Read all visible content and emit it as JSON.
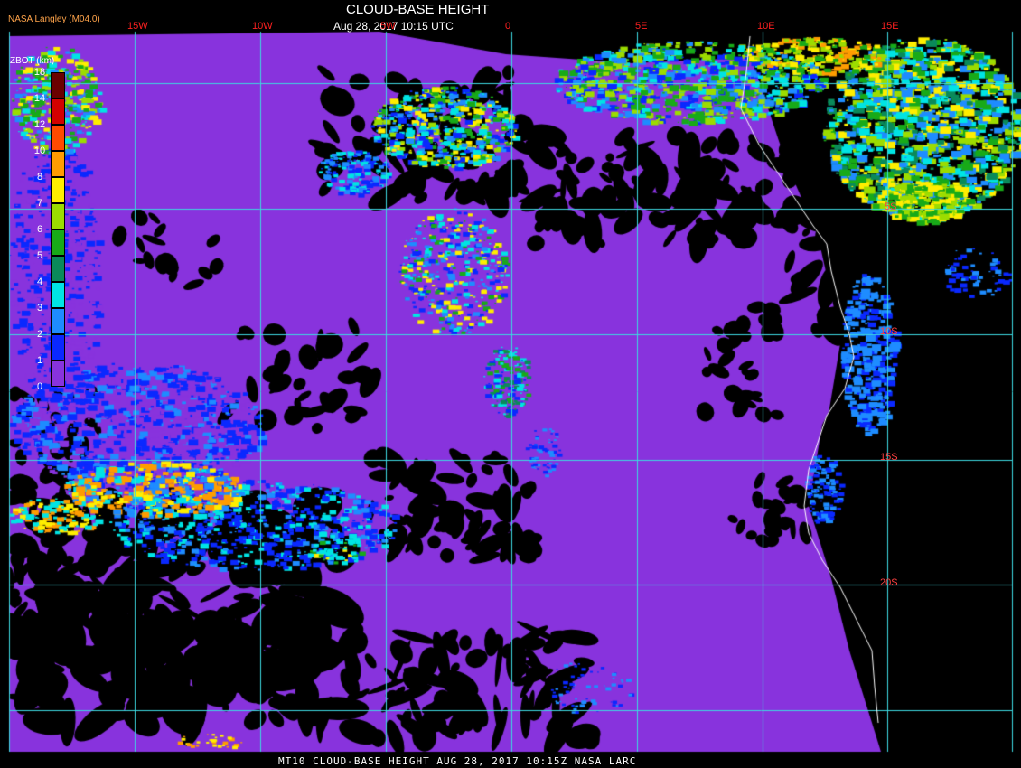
{
  "header": {
    "credit": "NASA Langley (M04.0)",
    "title": "CLOUD-BASE HEIGHT",
    "subtitle": "Aug 28, 2017 10:15 UTC"
  },
  "footer": {
    "caption": "MT10  CLOUD-BASE HEIGHT   AUG 28, 2017 10:15Z   NASA LARC"
  },
  "colorbar": {
    "title": "ZBOT (km)",
    "ticks": [
      "18",
      "14",
      "12",
      "10",
      "8",
      "7",
      "6",
      "5",
      "4",
      "3",
      "2",
      "1",
      "0"
    ],
    "colors": [
      "#6b0000",
      "#d40000",
      "#ff4a00",
      "#ff9c00",
      "#ffee00",
      "#9cdc00",
      "#18aa18",
      "#0a8a5a",
      "#00e4e4",
      "#1e8cff",
      "#0a28ff",
      "#8833dd"
    ]
  },
  "grid": {
    "lon_labels": [
      "15W",
      "10W",
      "5W",
      "0",
      "5E",
      "10E",
      "15E"
    ],
    "lat_labels": [
      "5S",
      "10S",
      "15S",
      "20S"
    ]
  },
  "colors": {
    "credit_text": "#ffa44a",
    "title_text": "#ffffff",
    "lon_label_text": "#ff2020",
    "lat_label_text": "#ff4040",
    "grid_line": "#3cd9e0",
    "coastline": "#ffffff",
    "no_cloud": "#000000"
  }
}
